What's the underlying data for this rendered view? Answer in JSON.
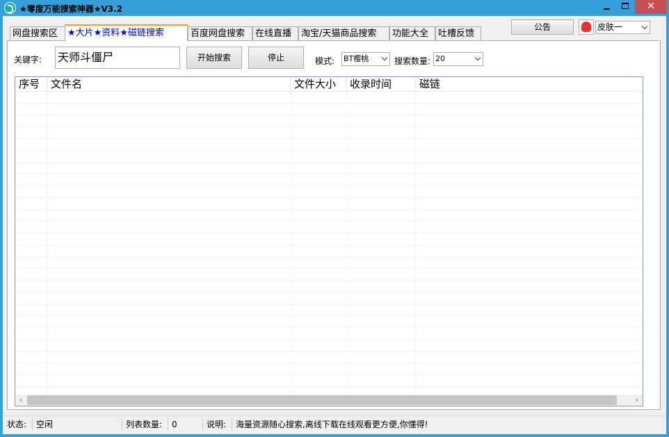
{
  "window": {
    "title": "★零度万能搜索神器★V3.2",
    "close_glyph": "✕"
  },
  "tabs": [
    {
      "label": "网盘搜索区",
      "active": false
    },
    {
      "label": "★大片★资料★磁链搜索",
      "active": true
    },
    {
      "label": "百度网盘搜索",
      "active": false
    },
    {
      "label": "在线直播",
      "active": false
    },
    {
      "label": "淘宝/天猫商品搜索",
      "active": false
    },
    {
      "label": "功能大全",
      "active": false
    },
    {
      "label": "吐槽反馈",
      "active": false
    }
  ],
  "topbar": {
    "notice_label": "公告",
    "skin_icon": "qq-penguin-icon",
    "skin_value": "皮肤一"
  },
  "search": {
    "keyword_label": "关键字:",
    "keyword_value": "天师斗僵尸",
    "start_label": "开始搜索",
    "stop_label": "停止",
    "mode_label": "模式:",
    "mode_value": "BT樱桃",
    "count_label": "搜索数量:",
    "count_value": "20"
  },
  "results": {
    "columns": [
      "序号",
      "文件名",
      "文件大小",
      "收录时间",
      "磁链"
    ],
    "rows": []
  },
  "status": {
    "state_label": "状态:",
    "state_value": "空闲",
    "count_label": "列表数量:",
    "count_value": "0",
    "note_label": "说明:",
    "note_value": "海量资源随心搜索,离线下载在线观看更方便,你懂得!"
  },
  "colors": {
    "titlebar": "#36a0db",
    "close_button": "#c7504f",
    "active_tab_accent": "#ff9a2e",
    "active_tab_text": "#0000cc"
  }
}
